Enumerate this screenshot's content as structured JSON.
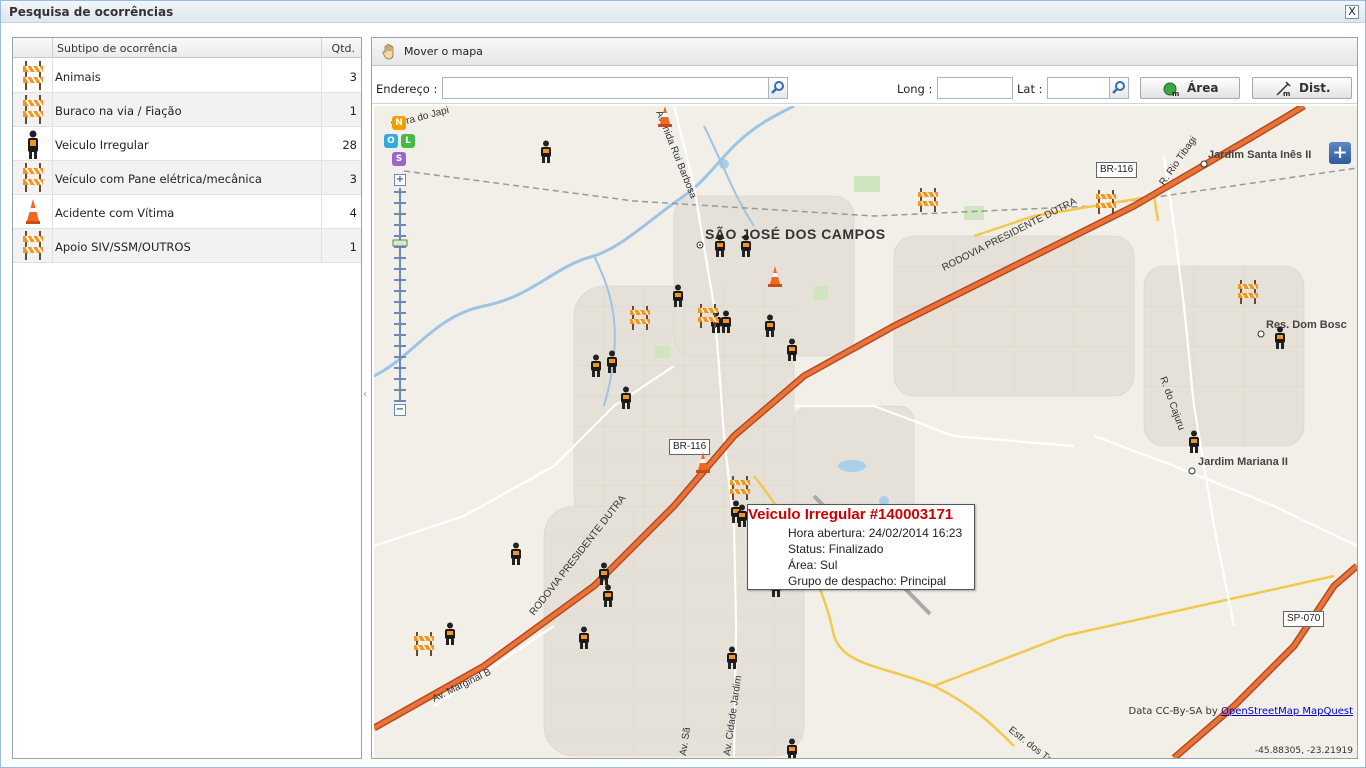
{
  "window": {
    "title": "Pesquisa de ocorrências",
    "close_label": "X"
  },
  "list": {
    "headers": {
      "name": "Subtipo de ocorrência",
      "qty": "Qtd."
    },
    "rows": [
      {
        "icon": "barrier-icon",
        "name": "Animais",
        "qty": "3"
      },
      {
        "icon": "barrier-icon",
        "name": "Buraco na via / Fiação",
        "qty": "1"
      },
      {
        "icon": "officer-icon",
        "name": "Veiculo Irregular",
        "qty": "28"
      },
      {
        "icon": "barrier-icon",
        "name": "Veículo com Pane elétrica/mecânica",
        "qty": "3"
      },
      {
        "icon": "traffic-cone-icon",
        "name": "Acidente com Vítima",
        "qty": "4"
      },
      {
        "icon": "barrier-icon",
        "name": "Apoio SIV/SSM/OUTROS",
        "qty": "1"
      }
    ]
  },
  "toolbar": {
    "pan_label": "Mover o mapa",
    "address_label": "Endereço :",
    "address_value": "",
    "long_label": "Long :",
    "long_value": "",
    "lat_label": "Lat :",
    "lat_value": "",
    "area_label": "Área",
    "dist_label": "Dist."
  },
  "map": {
    "layer_buttons": [
      "N",
      "O",
      "L",
      "S"
    ],
    "zoom_in": "+",
    "zoom_out": "−",
    "expand": "+",
    "city": "SÃO JOSÉ DOS CAMPOS",
    "places": [
      "Jardim Santa Inês II",
      "Res. Dom Bosc",
      "Jardim Mariana II"
    ],
    "shields": [
      "BR-116",
      "BR-116",
      "SP-070"
    ],
    "road_labels": [
      "RODOVIA PRESIDENTE DUTRA",
      "RODOVIA PRESIDENTE DUTRA",
      "Serra do Japi",
      "Avenida Rui Barbosa",
      "R. Rio Tibagi",
      "R. do Cajuru",
      "Av. Marginal B",
      "Av. Cidade Jardim",
      "Estr. dos Tamo",
      "Av. Sã"
    ],
    "attribution_prefix": "Data CC-By-SA by",
    "attribution_links": "OpenStreetMap MapQuest",
    "coords": "-45.88305, -23.21919",
    "popup": {
      "title": "Veiculo Irregular #140003171",
      "lines": [
        "Hora abertura: 24/02/2014 16:23",
        "Status: Finalizado",
        "Área: Sul",
        "Grupo de despacho: Principal"
      ]
    }
  },
  "colors": {
    "highway": "#e8743b",
    "highway_casing": "#b84a1e",
    "river": "#9cc4e4",
    "land": "#f2efe9",
    "popup_title": "#d00000",
    "accent": "#2f5aa0"
  }
}
